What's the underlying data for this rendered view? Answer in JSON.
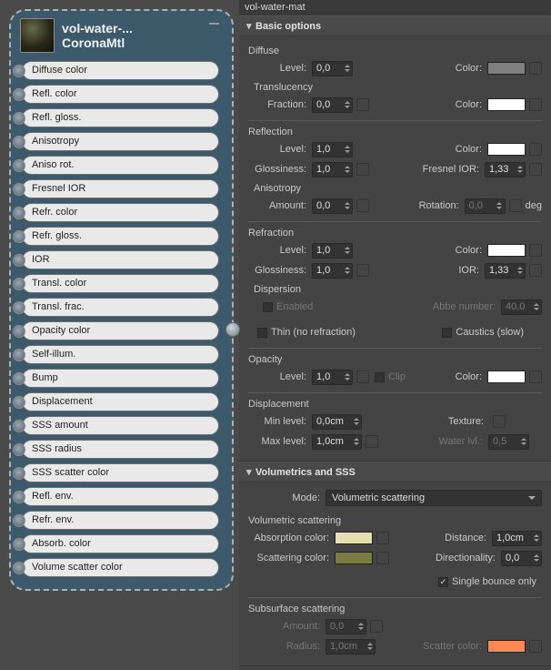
{
  "node": {
    "title": "vol-water-...",
    "subtitle": "CoronaMtl",
    "slots": [
      "Diffuse color",
      "Refl. color",
      "Refl. gloss.",
      "Anisotropy",
      "Aniso rot.",
      "Fresnel IOR",
      "Refr. color",
      "Refr. gloss.",
      "IOR",
      "Transl. color",
      "Transl. frac.",
      "Opacity color",
      "Self-illum.",
      "Bump",
      "Displacement",
      "SSS amount",
      "SSS radius",
      "SSS scatter color",
      "Refl. env.",
      "Refr. env.",
      "Absorb. color",
      "Volume scatter color"
    ]
  },
  "right": {
    "rollout_title": "vol-water-mat",
    "basic_options": {
      "title": "Basic options",
      "diffuse": {
        "label": "Diffuse",
        "level_label": "Level:",
        "level": "0,0",
        "color_label": "Color:"
      },
      "translucency": {
        "label": "Translucency",
        "fraction_label": "Fraction:",
        "fraction": "0,0",
        "color_label": "Color:"
      },
      "reflection": {
        "label": "Reflection",
        "level_label": "Level:",
        "level": "1,0",
        "color_label": "Color:",
        "gloss_label": "Glossiness:",
        "gloss": "1,0",
        "fresnel_label": "Fresnel IOR:",
        "fresnel": "1,33",
        "anisotropy_label": "Anisotropy",
        "amount_label": "Amount:",
        "amount": "0,0",
        "rotation_label": "Rotation:",
        "rotation": "0,0",
        "rotation_unit": "deg"
      },
      "refraction": {
        "label": "Refraction",
        "level_label": "Level:",
        "level": "1,0",
        "color_label": "Color:",
        "gloss_label": "Glossiness:",
        "gloss": "1,0",
        "ior_label": "IOR:",
        "ior": "1,33",
        "dispersion_label": "Dispersion",
        "enabled_label": "Enabled",
        "abbe_label": "Abbe number:",
        "abbe": "40,0",
        "thin_label": "Thin (no refraction)",
        "caustics_label": "Caustics (slow)"
      },
      "opacity": {
        "label": "Opacity",
        "level_label": "Level:",
        "level": "1,0",
        "clip_label": "Clip",
        "color_label": "Color:"
      },
      "displacement": {
        "label": "Displacement",
        "min_label": "Min level:",
        "min": "0,0cm",
        "texture_label": "Texture:",
        "max_label": "Max level:",
        "max": "1,0cm",
        "water_label": "Water lvl.:",
        "water": "0,5"
      }
    },
    "volumetrics": {
      "title": "Volumetrics and SSS",
      "mode_label": "Mode:",
      "mode_value": "Volumetric scattering",
      "vol_label": "Volumetric scattering",
      "abs_label": "Absorption color:",
      "dist_label": "Distance:",
      "dist": "1,0cm",
      "scat_label": "Scattering color:",
      "dir_label": "Directionality:",
      "dir": "0,0",
      "single_label": "Single bounce only",
      "sss_label": "Subsurface scattering",
      "amount_label": "Amount:",
      "amount": "0,0",
      "radius_label": "Radius:",
      "radius": "1,0cm",
      "scatter_color_label": "Scatter color:"
    }
  }
}
